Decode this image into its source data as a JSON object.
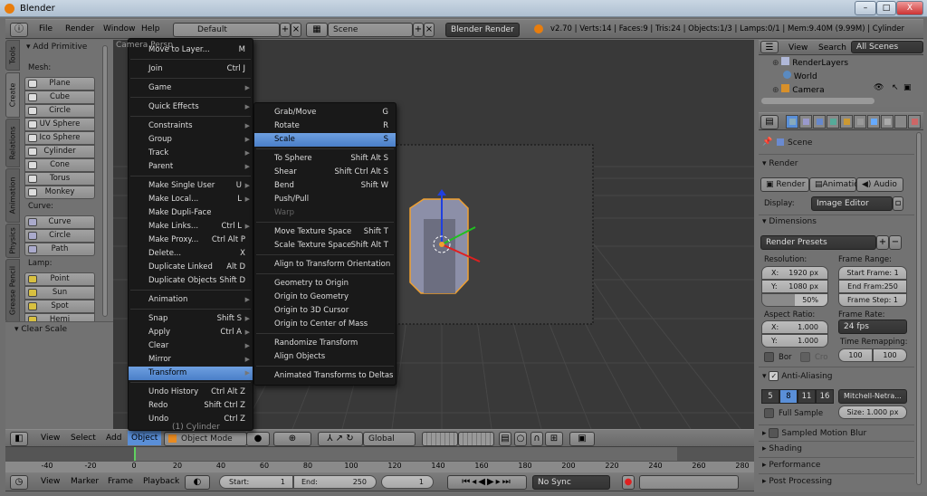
{
  "window": {
    "title": "Blender",
    "minimize": "–",
    "maximize": "□",
    "close": "X"
  },
  "info_header": {
    "menus": [
      "File",
      "Render",
      "Window",
      "Help"
    ],
    "layout": "Default",
    "scene": "Scene",
    "engine": "Blender Render",
    "stats": "v2.70 | Verts:14 | Faces:9 | Tris:24 | Objects:1/3 | Lamps:0/1 | Mem:9.40M (9.99M) | Cylinder"
  },
  "toolshelf": {
    "tabs": [
      "Tools",
      "Create",
      "Relations",
      "Animation",
      "Physics",
      "Grease Pencil"
    ],
    "active_tab": "Create",
    "panel": "Add Primitive",
    "groups": [
      {
        "label": "Mesh:",
        "items": [
          "Plane",
          "Cube",
          "Circle",
          "UV Sphere",
          "Ico Sphere",
          "Cylinder",
          "Cone",
          "Torus",
          "Monkey"
        ]
      },
      {
        "label": "Curve:",
        "items": [
          "Curve",
          "Circle",
          "Path"
        ]
      },
      {
        "label": "Lamp:",
        "items": [
          "Point",
          "Sun",
          "Spot",
          "Hemi"
        ]
      }
    ],
    "operator_panel": "Clear Scale"
  },
  "viewport": {
    "object_label": "(1) Cylinder",
    "camera_label": "Camera Persp"
  },
  "object_menu": {
    "items": [
      {
        "label": "Move to Layer...",
        "key": "M"
      },
      {
        "sep": true
      },
      {
        "label": "Join",
        "key": "Ctrl J"
      },
      {
        "sep": true
      },
      {
        "label": "Game",
        "sub": true
      },
      {
        "sep": true
      },
      {
        "label": "Quick Effects",
        "sub": true
      },
      {
        "sep": true
      },
      {
        "label": "Constraints",
        "sub": true
      },
      {
        "label": "Group",
        "sub": true
      },
      {
        "label": "Track",
        "sub": true
      },
      {
        "label": "Parent",
        "sub": true
      },
      {
        "sep": true
      },
      {
        "label": "Make Single User",
        "key": "U",
        "sub": true
      },
      {
        "label": "Make Local...",
        "key": "L",
        "sub": true
      },
      {
        "label": "Make Dupli-Face"
      },
      {
        "label": "Make Links...",
        "key": "Ctrl L",
        "sub": true
      },
      {
        "label": "Make Proxy...",
        "key": "Ctrl Alt P"
      },
      {
        "label": "Delete...",
        "key": "X"
      },
      {
        "label": "Duplicate Linked",
        "key": "Alt D"
      },
      {
        "label": "Duplicate Objects",
        "key": "Shift D"
      },
      {
        "sep": true
      },
      {
        "label": "Animation",
        "sub": true
      },
      {
        "sep": true
      },
      {
        "label": "Snap",
        "key": "Shift S",
        "sub": true
      },
      {
        "label": "Apply",
        "key": "Ctrl A",
        "sub": true
      },
      {
        "label": "Clear",
        "sub": true
      },
      {
        "label": "Mirror",
        "sub": true
      },
      {
        "label": "Transform",
        "sub": true,
        "highlight": true
      },
      {
        "sep": true
      },
      {
        "label": "Undo History",
        "key": "Ctrl Alt Z"
      },
      {
        "label": "Redo",
        "key": "Shift Ctrl Z"
      },
      {
        "label": "Undo",
        "key": "Ctrl Z"
      }
    ]
  },
  "transform_menu": {
    "items": [
      {
        "label": "Grab/Move",
        "key": "G"
      },
      {
        "label": "Rotate",
        "key": "R"
      },
      {
        "label": "Scale",
        "key": "S",
        "highlight": true
      },
      {
        "sep": true
      },
      {
        "label": "To Sphere",
        "key": "Shift Alt S"
      },
      {
        "label": "Shear",
        "key": "Shift Ctrl Alt S"
      },
      {
        "label": "Bend",
        "key": "Shift W"
      },
      {
        "label": "Push/Pull"
      },
      {
        "label": "Warp",
        "disabled": true
      },
      {
        "sep": true
      },
      {
        "label": "Move Texture Space",
        "key": "Shift T"
      },
      {
        "label": "Scale Texture Space",
        "key": "Shift Alt T"
      },
      {
        "sep": true
      },
      {
        "label": "Align to Transform Orientation"
      },
      {
        "sep": true
      },
      {
        "label": "Geometry to Origin"
      },
      {
        "label": "Origin to Geometry"
      },
      {
        "label": "Origin to 3D Cursor"
      },
      {
        "label": "Origin to Center of Mass"
      },
      {
        "sep": true
      },
      {
        "label": "Randomize Transform"
      },
      {
        "label": "Align Objects"
      },
      {
        "sep": true
      },
      {
        "label": "Animated Transforms to Deltas"
      }
    ]
  },
  "view3d_header": {
    "menus": [
      "View",
      "Select",
      "Add",
      "Object"
    ],
    "active_menu": "Object",
    "mode": "Object Mode",
    "orientation": "Global"
  },
  "timeline": {
    "ticks": [
      -40,
      -20,
      0,
      20,
      40,
      60,
      80,
      100,
      120,
      140,
      160,
      180,
      200,
      220,
      240,
      260,
      280
    ],
    "current_frame": 1,
    "start": 1,
    "end": 250,
    "header": {
      "menus": [
        "View",
        "Marker",
        "Frame",
        "Playback"
      ],
      "start_label": "Start:",
      "start": "1",
      "end_label": "End:",
      "end": "250",
      "frame": "1",
      "sync": "No Sync"
    }
  },
  "outliner": {
    "menus": [
      "View",
      "Search"
    ],
    "filter": "All Scenes",
    "items": [
      "RenderLayers",
      "World",
      "Camera"
    ]
  },
  "properties": {
    "context": "Scene",
    "render": {
      "title": "Render",
      "buttons": [
        "Render",
        "Animation",
        "Audio"
      ],
      "display_label": "Display:",
      "display": "Image Editor"
    },
    "dimensions": {
      "title": "Dimensions",
      "presets": "Render Presets",
      "resolution_label": "Resolution:",
      "res_x": "X:",
      "res_x_val": "1920 px",
      "res_y": "Y:",
      "res_y_val": "1080 px",
      "res_pct": "50%",
      "res_pct_value": 50,
      "frame_range_label": "Frame Range:",
      "start_frame": "Start Frame: 1",
      "end_frame": "End Fram:250",
      "frame_step": "Frame Step: 1",
      "aspect_label": "Aspect Ratio:",
      "asp_x": "X:",
      "asp_x_val": "1.000",
      "asp_y": "Y:",
      "asp_y_val": "1.000",
      "border": "Bor",
      "crop": "Cro",
      "frame_rate_label": "Frame Rate:",
      "frame_rate": "24 fps",
      "time_remap_label": "Time Remapping:",
      "remap_old": "100",
      "remap_new": "100"
    },
    "aa": {
      "title": "Anti-Aliasing",
      "enabled": true,
      "samples": [
        "5",
        "8",
        "11",
        "16"
      ],
      "selected": "8",
      "filter": "Mitchell-Netra...",
      "full_sample": "Full Sample",
      "size": "Size: 1.000 px"
    },
    "collapsed": [
      "Sampled Motion Blur",
      "Shading",
      "Performance",
      "Post Processing"
    ]
  },
  "colors": {
    "highlight": "#5a8fd8",
    "viewport": "#393939",
    "panel": "#727272",
    "menu": "#191919",
    "selection": "#f0a030"
  }
}
